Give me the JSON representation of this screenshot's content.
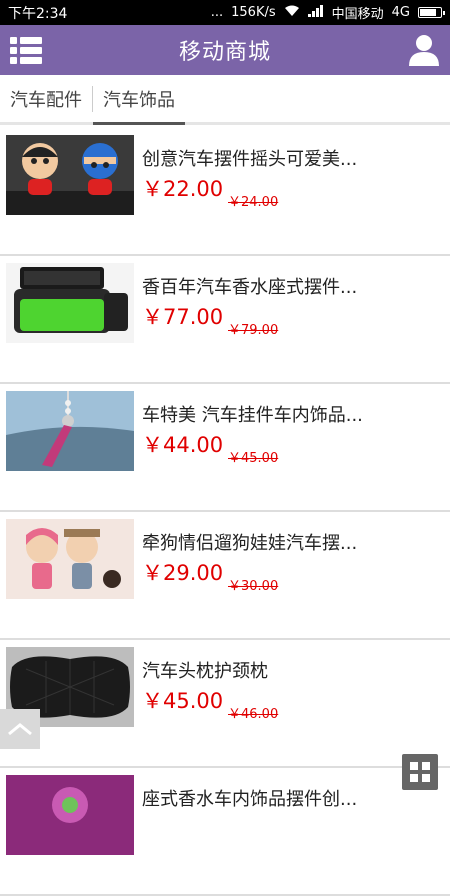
{
  "status_bar": {
    "time": "下午2:34",
    "dots": "...",
    "speed": "156K/s",
    "carrier": "中国移动",
    "network": "4G",
    "battery_level": 0.85
  },
  "app_bar": {
    "title": "移动商城",
    "menu_icon": "menu-icon",
    "user_icon": "user-icon",
    "color": "#7b64a8"
  },
  "tabs": [
    {
      "label": "汽车配件",
      "active": false
    },
    {
      "label": "汽车饰品",
      "active": true
    }
  ],
  "products": [
    {
      "name": "创意汽车摆件摇头可爱美...",
      "price": "￥22.00",
      "old_price": "￥24.00"
    },
    {
      "name": "香百年汽车香水座式摆件...",
      "price": "￥77.00",
      "old_price": "￥79.00"
    },
    {
      "name": "车特美 汽车挂件车内饰品...",
      "price": "￥44.00",
      "old_price": "￥45.00"
    },
    {
      "name": "牵狗情侣遛狗娃娃汽车摆...",
      "price": "￥29.00",
      "old_price": "￥30.00"
    },
    {
      "name": "汽车头枕护颈枕",
      "price": "￥45.00",
      "old_price": "￥46.00"
    },
    {
      "name": "座式香水车内饰品摆件创...",
      "price": "",
      "old_price": ""
    }
  ],
  "colors": {
    "price": "#e00000"
  }
}
